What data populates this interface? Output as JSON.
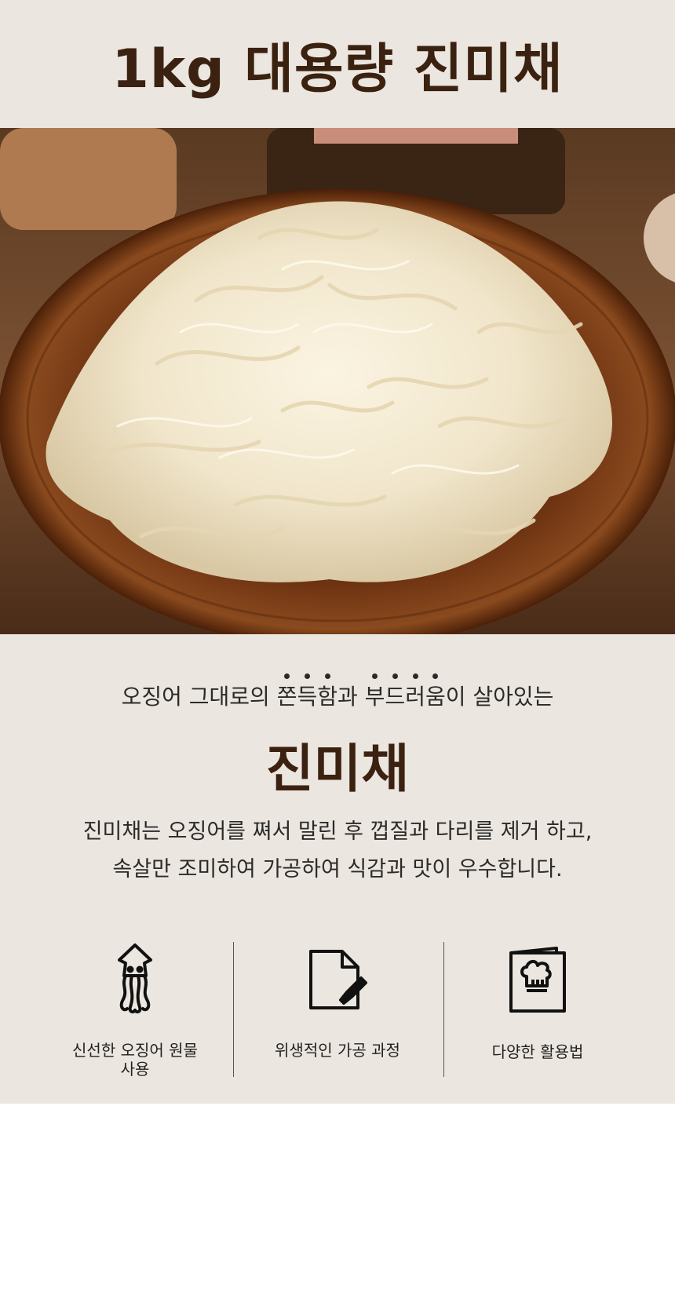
{
  "header": {
    "title": "1kg 대용량 진미채"
  },
  "intro": {
    "subtitle_before": "오징어 그대로의 ",
    "subtitle_em1": "쫀득함",
    "subtitle_mid": "과 ",
    "subtitle_em2": "부드러움",
    "subtitle_after": "이 살아있는",
    "product_name": "진미채",
    "description_line1": "진미채는 오징어를 쪄서 말린 후 껍질과 다리를 제거 하고,",
    "description_line2": "속살만 조미하여 가공하여 식감과 맛이 우수합니다."
  },
  "features": [
    {
      "icon": "squid-icon",
      "label_line1": "신선한 오징어 원물",
      "label_line2": "사용"
    },
    {
      "icon": "document-edit-icon",
      "label_line1": "위생적인 가공 과정",
      "label_line2": ""
    },
    {
      "icon": "recipe-book-icon",
      "label_line1": "다양한 활용법",
      "label_line2": ""
    }
  ],
  "colors": {
    "background": "#ebe6df",
    "title_brown": "#3b2110",
    "text": "#2a2a2a"
  }
}
